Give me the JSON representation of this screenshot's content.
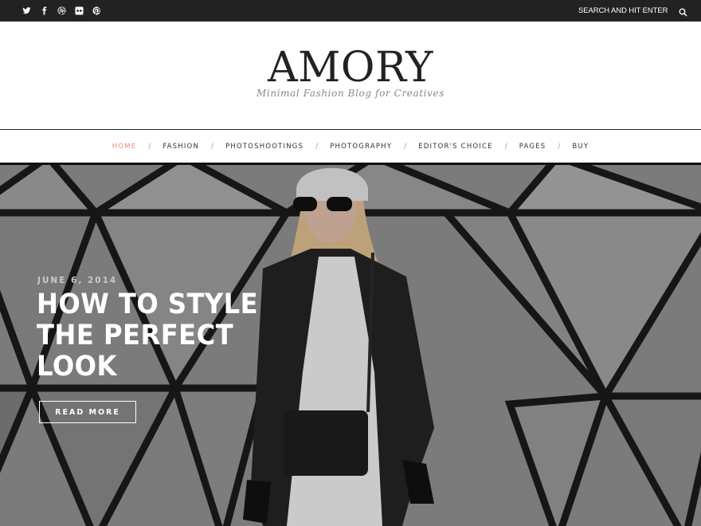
{
  "topbar": {
    "social": [
      {
        "name": "twitter-icon",
        "label": "Twitter"
      },
      {
        "name": "facebook-icon",
        "label": "Facebook"
      },
      {
        "name": "dribbble-icon",
        "label": "Dribbble"
      },
      {
        "name": "flickr-icon",
        "label": "Flickr"
      },
      {
        "name": "pinterest-icon",
        "label": "Pinterest"
      }
    ],
    "search_placeholder": "SEARCH AND HIT ENTER...",
    "search_icon": "search-icon"
  },
  "logo": {
    "title": "AMORY",
    "tagline": "Minimal Fashion Blog for Creatives"
  },
  "nav": {
    "items": [
      {
        "label": "HOME",
        "active": true
      },
      {
        "label": "FASHION",
        "active": false
      },
      {
        "label": "PHOTOSHOOTINGS",
        "active": false
      },
      {
        "label": "PHOTOGRAPHY",
        "active": false
      },
      {
        "label": "EDITOR'S CHOICE",
        "active": false
      },
      {
        "label": "PAGES",
        "active": false
      },
      {
        "label": "BUY",
        "active": false
      }
    ],
    "separator": "/"
  },
  "hero": {
    "date": "JUNE 6, 2014",
    "title": "HOW TO STYLE THE PERFECT LOOK",
    "button": "READ MORE"
  },
  "colors": {
    "topbar_bg": "#222222",
    "accent": "#e98c7a",
    "text": "#222222"
  }
}
